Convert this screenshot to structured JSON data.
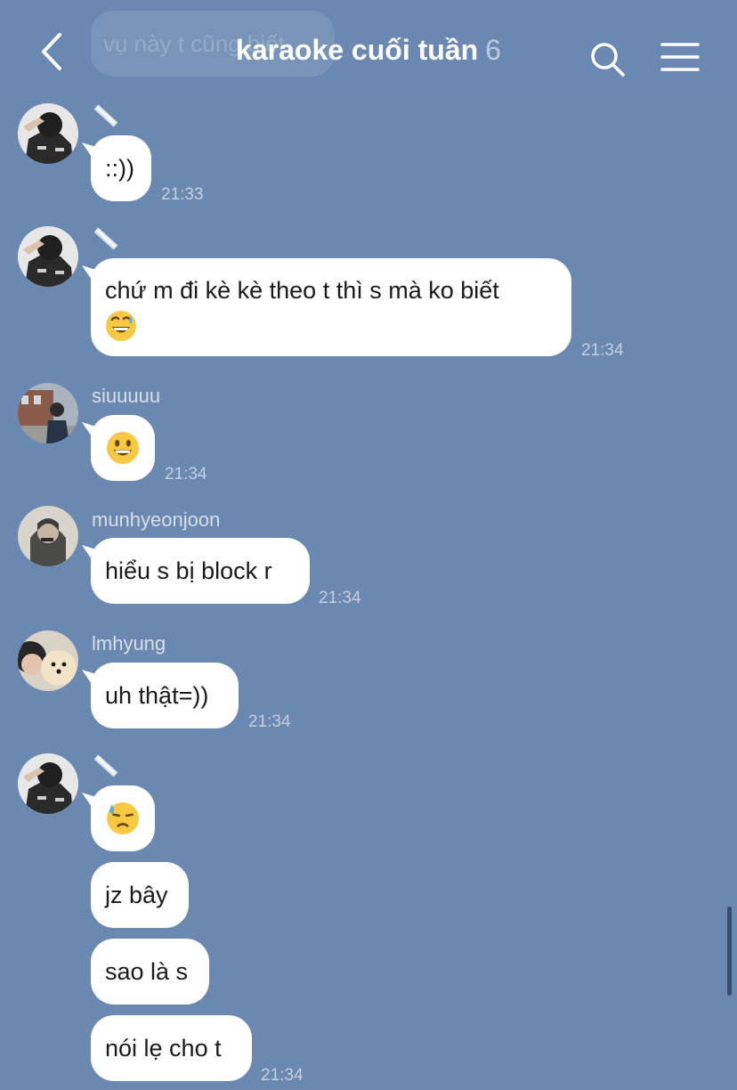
{
  "header": {
    "title": "karaoke cuối tuần",
    "member_count": "6",
    "back_icon": "chevron-left-icon",
    "search_icon": "search-icon",
    "menu_icon": "hamburger-menu-icon",
    "ghost_message": "vụ này t cũng biết"
  },
  "messages": [
    {
      "sender": "",
      "text": "::))",
      "time": "21:33"
    },
    {
      "sender": "",
      "text_line1": "chứ m đi kè kè theo t thì s mà ko biết",
      "emoji": "grinning-sweat-emoji",
      "time": "21:34"
    },
    {
      "sender": "siuuuuu",
      "emoji": "smiley-emoji",
      "time": "21:34"
    },
    {
      "sender": "munhyeonjoon",
      "text": "hiểu s bị block r",
      "time": "21:34"
    },
    {
      "sender": "lmhyung",
      "text": "uh thật=))",
      "time": "21:34"
    },
    {
      "sender": "",
      "emoji": "downcast-sweat-emoji",
      "time": ""
    },
    {
      "sender": "",
      "text": "jz bây",
      "time": ""
    },
    {
      "sender": "",
      "text": "sao là s",
      "time": ""
    },
    {
      "sender": "",
      "text": "nói lẹ cho t",
      "time": "21:34"
    }
  ],
  "colors": {
    "background": "#6a88b0",
    "bubble": "#ffffff",
    "text": "#1a1a1a"
  }
}
